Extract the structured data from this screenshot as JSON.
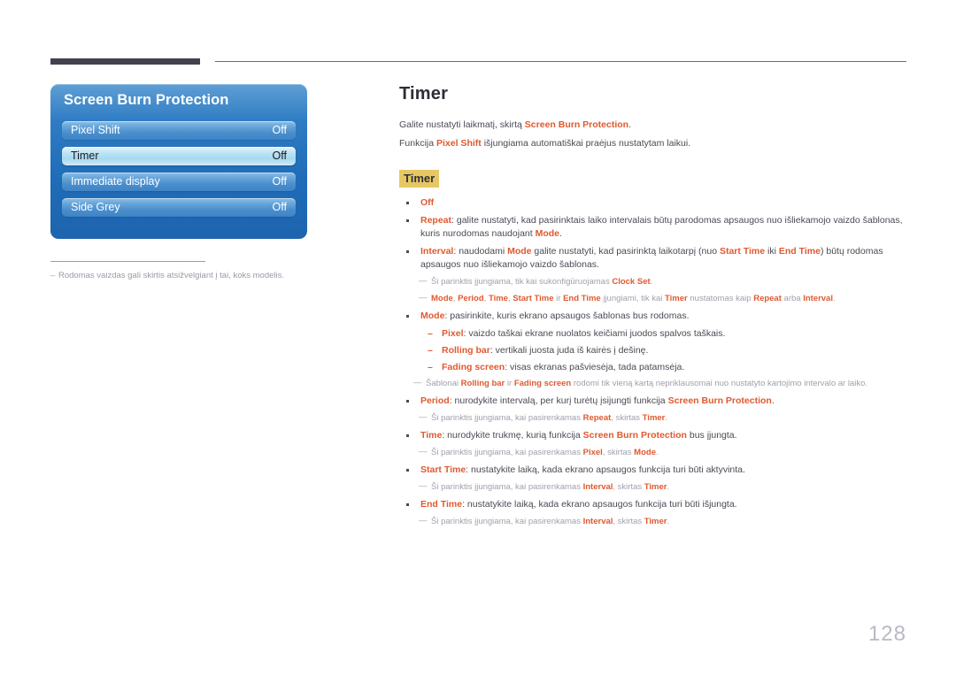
{
  "page": {
    "number": "128"
  },
  "osd": {
    "title": "Screen Burn Protection",
    "rows": [
      {
        "label": "Pixel Shift",
        "value": "Off",
        "selected": false
      },
      {
        "label": "Timer",
        "value": "Off",
        "selected": true
      },
      {
        "label": "Immediate display",
        "value": "Off",
        "selected": false
      },
      {
        "label": "Side Grey",
        "value": "Off",
        "selected": false
      }
    ],
    "footnote_marker": "–",
    "footnote": "Rodomas vaizdas gali skirtis atsižvelgiant į tai, koks modelis."
  },
  "content": {
    "title": "Timer",
    "intro": [
      {
        "pre": "Galite nustatyti laikmatį, skirtą ",
        "em": "Screen Burn Protection",
        "post": "."
      },
      {
        "pre": "Funkcija ",
        "em": "Pixel Shift",
        "post": " išjungiama automatiškai praėjus nustatytam laikui."
      }
    ],
    "sub_head": "Timer",
    "items": [
      {
        "kind": "bullet",
        "marker": "▪",
        "parts": [
          {
            "t": "em",
            "v": "Off"
          }
        ]
      },
      {
        "kind": "bullet",
        "marker": "▪",
        "parts": [
          {
            "t": "em",
            "v": "Repeat"
          },
          {
            "t": "n",
            "v": ": galite nustatyti, kad pasirinktais laiko intervalais būtų parodomas apsaugos nuo išliekamojo vaizdo šablonas, kuris nurodomas naudojant "
          },
          {
            "t": "em",
            "v": "Mode"
          },
          {
            "t": "n",
            "v": "."
          }
        ]
      },
      {
        "kind": "bullet",
        "marker": "▪",
        "parts": [
          {
            "t": "em",
            "v": "Interval"
          },
          {
            "t": "n",
            "v": ": naudodami "
          },
          {
            "t": "em",
            "v": "Mode"
          },
          {
            "t": "n",
            "v": " galite nustatyti, kad pasirinktą laikotarpį (nuo "
          },
          {
            "t": "em",
            "v": "Start Time"
          },
          {
            "t": "n",
            "v": " iki "
          },
          {
            "t": "em",
            "v": "End Time"
          },
          {
            "t": "n",
            "v": ") būtų rodomas apsaugos nuo išliekamojo vaizdo šablonas."
          }
        ]
      },
      {
        "kind": "note",
        "marker": "—",
        "parts": [
          {
            "t": "g",
            "v": "Ši parinktis įjungiama, tik kai sukonfigūruojamas "
          },
          {
            "t": "em",
            "v": "Clock Set"
          },
          {
            "t": "g",
            "v": "."
          }
        ]
      },
      {
        "kind": "note",
        "marker": "—",
        "parts": [
          {
            "t": "em",
            "v": "Mode"
          },
          {
            "t": "g",
            "v": ", "
          },
          {
            "t": "em",
            "v": "Period"
          },
          {
            "t": "g",
            "v": ", "
          },
          {
            "t": "em",
            "v": "Time"
          },
          {
            "t": "g",
            "v": ", "
          },
          {
            "t": "em",
            "v": "Start Time"
          },
          {
            "t": "g",
            "v": " ir "
          },
          {
            "t": "em",
            "v": "End Time"
          },
          {
            "t": "g",
            "v": " įjungiami, tik kai "
          },
          {
            "t": "em",
            "v": "Timer"
          },
          {
            "t": "g",
            "v": " nustatomas kaip "
          },
          {
            "t": "em",
            "v": "Repeat"
          },
          {
            "t": "g",
            "v": " arba "
          },
          {
            "t": "em",
            "v": "Interval"
          },
          {
            "t": "g",
            "v": "."
          }
        ]
      },
      {
        "kind": "bullet",
        "marker": "▪",
        "parts": [
          {
            "t": "em",
            "v": "Mode"
          },
          {
            "t": "n",
            "v": ": pasirinkite, kuris ekrano apsaugos šablonas bus rodomas."
          }
        ]
      },
      {
        "kind": "subbullet",
        "marker": "–",
        "parts": [
          {
            "t": "em",
            "v": "Pixel"
          },
          {
            "t": "n",
            "v": ": vaizdo taškai ekrane nuolatos keičiami juodos spalvos taškais."
          }
        ]
      },
      {
        "kind": "subbullet",
        "marker": "–",
        "parts": [
          {
            "t": "em",
            "v": "Rolling bar"
          },
          {
            "t": "n",
            "v": ": vertikali juosta juda iš kairės į dešinę."
          }
        ]
      },
      {
        "kind": "subbullet",
        "marker": "–",
        "parts": [
          {
            "t": "em",
            "v": "Fading screen"
          },
          {
            "t": "n",
            "v": ": visas ekranas pašviesėja, tada patamsėja."
          }
        ]
      },
      {
        "kind": "note",
        "marker": "—",
        "parts": [
          {
            "t": "g",
            "v": "Šablonai "
          },
          {
            "t": "em",
            "v": "Rolling bar"
          },
          {
            "t": "g",
            "v": " ir "
          },
          {
            "t": "em",
            "v": "Fading screen"
          },
          {
            "t": "g",
            "v": " rodomi tik vieną kartą nepriklausomai nuo nustatyto kartojimo intervalo ar laiko."
          }
        ]
      },
      {
        "kind": "bullet",
        "marker": "▪",
        "parts": [
          {
            "t": "em",
            "v": "Period"
          },
          {
            "t": "n",
            "v": ": nurodykite intervalą, per kurį turėtų įsijungti funkcija "
          },
          {
            "t": "em",
            "v": "Screen Burn Protection"
          },
          {
            "t": "n",
            "v": "."
          }
        ]
      },
      {
        "kind": "note",
        "marker": "—",
        "parts": [
          {
            "t": "g",
            "v": "Ši parinktis įjungiama, kai pasirenkamas "
          },
          {
            "t": "em",
            "v": "Repeat"
          },
          {
            "t": "g",
            "v": ", skirtas "
          },
          {
            "t": "em",
            "v": "Timer"
          },
          {
            "t": "g",
            "v": "."
          }
        ]
      },
      {
        "kind": "bullet",
        "marker": "▪",
        "parts": [
          {
            "t": "em",
            "v": "Time"
          },
          {
            "t": "n",
            "v": ": nurodykite trukmę, kurią funkcija "
          },
          {
            "t": "em",
            "v": "Screen Burn Protection"
          },
          {
            "t": "n",
            "v": " bus įjungta."
          }
        ]
      },
      {
        "kind": "note",
        "marker": "—",
        "parts": [
          {
            "t": "g",
            "v": "Ši parinktis įjungiama, kai pasirenkamas "
          },
          {
            "t": "em",
            "v": "Pixel"
          },
          {
            "t": "g",
            "v": ", skirtas "
          },
          {
            "t": "em",
            "v": "Mode"
          },
          {
            "t": "g",
            "v": "."
          }
        ]
      },
      {
        "kind": "bullet",
        "marker": "▪",
        "parts": [
          {
            "t": "em",
            "v": "Start Time"
          },
          {
            "t": "n",
            "v": ": nustatykite laiką, kada ekrano apsaugos funkcija turi būti aktyvinta."
          }
        ]
      },
      {
        "kind": "note",
        "marker": "—",
        "parts": [
          {
            "t": "g",
            "v": "Ši parinktis įjungiama, kai pasirenkamas "
          },
          {
            "t": "em",
            "v": "Interval"
          },
          {
            "t": "g",
            "v": ", skirtas "
          },
          {
            "t": "em",
            "v": "Timer"
          },
          {
            "t": "g",
            "v": "."
          }
        ]
      },
      {
        "kind": "bullet",
        "marker": "▪",
        "parts": [
          {
            "t": "em",
            "v": "End Time"
          },
          {
            "t": "n",
            "v": ": nustatykite laiką, kada ekrano apsaugos funkcija turi būti išjungta."
          }
        ]
      },
      {
        "kind": "note",
        "marker": "—",
        "parts": [
          {
            "t": "g",
            "v": "Ši parinktis įjungiama, kai pasirenkamas "
          },
          {
            "t": "em",
            "v": "Interval"
          },
          {
            "t": "g",
            "v": ", skirtas "
          },
          {
            "t": "em",
            "v": "Timer"
          },
          {
            "t": "g",
            "v": "."
          }
        ]
      }
    ]
  },
  "colors": {
    "accent_orange": "#e0592f",
    "highlight_yellow": "#e6c763",
    "osd_blue": "#2f7cc4",
    "note_grey": "#a0a0ad"
  }
}
